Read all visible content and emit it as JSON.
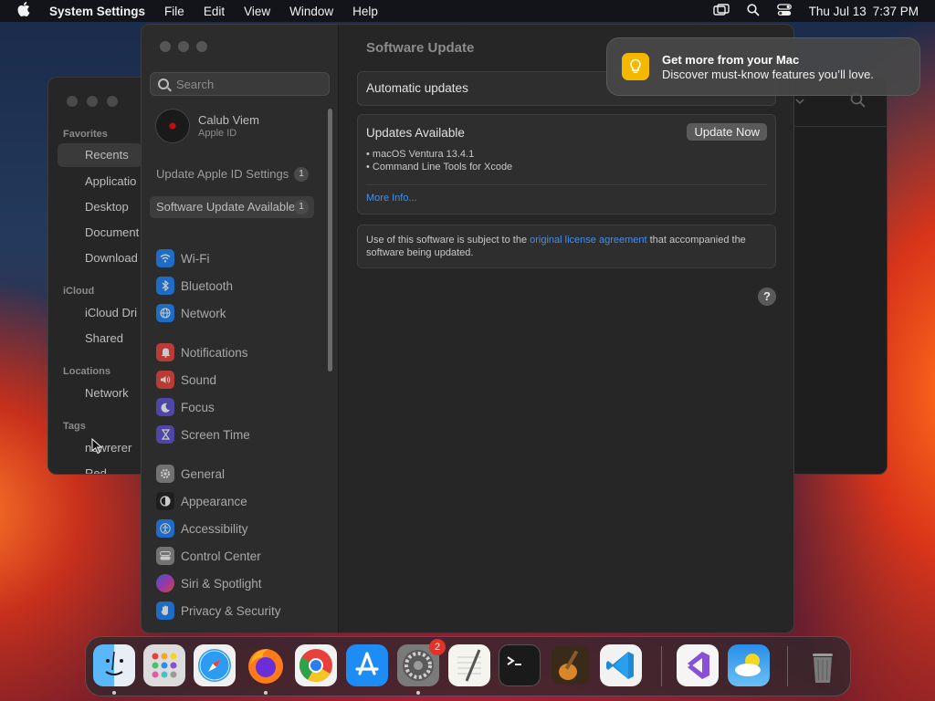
{
  "menubar": {
    "app_name": "System Settings",
    "menus": [
      "File",
      "Edit",
      "View",
      "Window",
      "Help"
    ],
    "date": "Thu Jul 13",
    "time": "7:37 PM"
  },
  "finder": {
    "sections": {
      "favorites": "Favorites",
      "icloud": "iCloud",
      "locations": "Locations",
      "tags": "Tags"
    },
    "items": {
      "recents": "Recents",
      "applications": "Applicatio",
      "desktop": "Desktop",
      "documents": "Document",
      "downloads": "Download",
      "icloud_drive": "iCloud Dri",
      "shared": "Shared",
      "network": "Network",
      "tag1": "newrerer",
      "tag2": "Red"
    }
  },
  "sidebar": {
    "search_placeholder": "Search",
    "profile": {
      "name": "Calub Viem",
      "subtitle": "Apple ID"
    },
    "rows": [
      {
        "label": "Update Apple ID Settings",
        "badge": "1"
      },
      {
        "label": "Software Update Available",
        "badge": "1"
      }
    ],
    "items": [
      {
        "label": "Wi-Fi",
        "icon": "wifi-icon",
        "color": "#1a82f7"
      },
      {
        "label": "Bluetooth",
        "icon": "bluetooth-icon",
        "color": "#1a82f7"
      },
      {
        "label": "Network",
        "icon": "globe-icon",
        "color": "#1a82f7"
      },
      {
        "label": "Notifications",
        "icon": "bell-icon",
        "color": "#e8403a"
      },
      {
        "label": "Sound",
        "icon": "speaker-icon",
        "color": "#e8403a"
      },
      {
        "label": "Focus",
        "icon": "moon-icon",
        "color": "#5c4fcf"
      },
      {
        "label": "Screen Time",
        "icon": "hourglass-icon",
        "color": "#5c4fcf"
      },
      {
        "label": "General",
        "icon": "gear-icon",
        "color": "#8a8a8a"
      },
      {
        "label": "Appearance",
        "icon": "appearance-icon",
        "color": "#1a1a1a"
      },
      {
        "label": "Accessibility",
        "icon": "accessibility-icon",
        "color": "#1a82f7"
      },
      {
        "label": "Control Center",
        "icon": "control-center-icon",
        "color": "#8a8a8a"
      },
      {
        "label": "Siri & Spotlight",
        "icon": "siri-icon",
        "color": "#c03ad6"
      },
      {
        "label": "Privacy & Security",
        "icon": "hand-icon",
        "color": "#1a82f7"
      }
    ]
  },
  "main": {
    "title": "Software Update",
    "automatic_updates": "Automatic updates",
    "updates_title": "Updates Available",
    "update_now": "Update Now",
    "updates": [
      "• macOS Ventura 13.4.1",
      "• Command Line Tools for Xcode"
    ],
    "more_info": "More Info...",
    "license_pre": "Use of this software is subject to the ",
    "license_link": "original license agreement",
    "license_post": " that accompanied the software being updated.",
    "help": "?"
  },
  "notification": {
    "title": "Get more from your Mac",
    "body": "Discover must-know features you’ll love."
  },
  "dock": {
    "apps": [
      {
        "name": "Finder",
        "color": "#2b8cf0",
        "running": true
      },
      {
        "name": "Launchpad",
        "color": "#e8e8e8",
        "running": false
      },
      {
        "name": "Safari",
        "color": "#2c9cf2",
        "running": false
      },
      {
        "name": "Firefox",
        "color": "#ff7a1a",
        "running": true
      },
      {
        "name": "Chrome",
        "color": "#f2f2f2",
        "running": false
      },
      {
        "name": "App Store",
        "color": "#1e8cf5",
        "running": false
      },
      {
        "name": "System Settings",
        "color": "#7a7a7a",
        "running": true,
        "badge": "2"
      },
      {
        "name": "TextEdit",
        "color": "#f5f5f0",
        "running": false
      },
      {
        "name": "Terminal",
        "color": "#1a1a1a",
        "running": false
      },
      {
        "name": "GarageBand",
        "color": "#c67a2a",
        "running": false
      },
      {
        "name": "Visual Studio Code",
        "color": "#f2f2f2",
        "running": false
      },
      {
        "name": "Visual Studio",
        "color": "#f5f5f5",
        "running": false
      },
      {
        "name": "Weather",
        "color": "#2a8ee8",
        "running": false
      },
      {
        "name": "Trash",
        "color": "#8a8a8a",
        "running": false
      }
    ]
  }
}
